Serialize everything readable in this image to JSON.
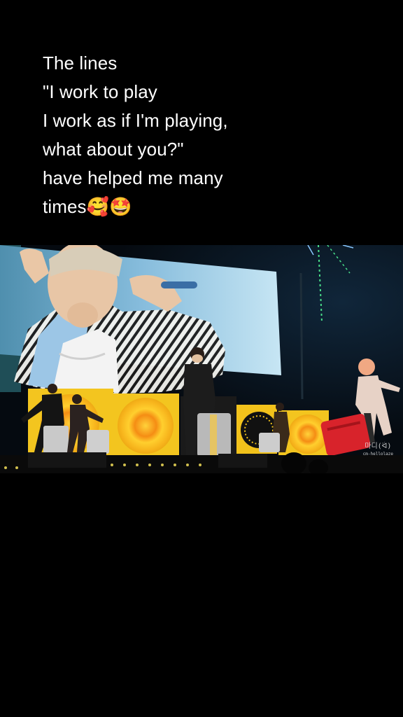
{
  "caption": {
    "lines": [
      "The lines",
      "\"I work to play",
      "I work as if I'm playing,",
      "what about you?\"",
      "have helped me many",
      "times🥰🤩"
    ]
  },
  "video": {
    "scene": "concert-stage",
    "colors": {
      "background": "#000000",
      "screen_sky": "#7fb4d6",
      "panel_yellow": "#f2c21b",
      "panel_orange": "#f08a12",
      "suitcase_red": "#d8232b"
    }
  },
  "watermark": {
    "main": "마디(ᐛ)",
    "sub": "cm-hellolaze"
  }
}
